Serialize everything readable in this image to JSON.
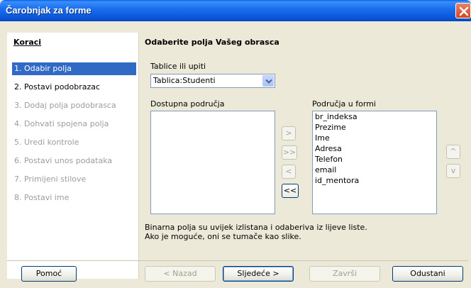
{
  "window": {
    "title": "Čarobnjak za forme"
  },
  "steps": {
    "heading": "Koraci",
    "items": [
      {
        "label": "1. Odabir polja"
      },
      {
        "label": "2. Postavi podobrazac"
      },
      {
        "label": "3. Dodaj polja podobrasca"
      },
      {
        "label": "4. Dohvati spojena polja"
      },
      {
        "label": "5. Uredi kontrole"
      },
      {
        "label": "6. Postavi unos podataka"
      },
      {
        "label": "7. Primijeni stilove"
      },
      {
        "label": "8. Postavi ime"
      }
    ]
  },
  "main": {
    "heading": "Odaberite polja Vašeg obrasca",
    "tables_label": "Tablice ili upiti",
    "table_selected": "Tablica:Studenti",
    "available_label": "Dostupna područja",
    "form_fields_label": "Područja u formi",
    "form_fields": [
      "br_indeksa",
      "Prezime",
      "Ime",
      "Adresa",
      "Telefon",
      "email",
      "id_mentora"
    ],
    "move": {
      "add_one": ">",
      "add_all": ">>",
      "remove_one": "<",
      "remove_all": "<<"
    },
    "order": {
      "up": "^",
      "down": "v"
    },
    "note_line1": "Binarna polja su uvijek izlistana i odaberiva iz lijeve liste.",
    "note_line2": "Ako je moguće, oni se tumače kao slike."
  },
  "buttons": {
    "help": "Pomoć",
    "back": "< Nazad",
    "next": "Sljedeće >",
    "finish": "Završi",
    "cancel": "Odustani"
  },
  "colors": {
    "selection": "#316ac5",
    "titlebar": "#0a5fe8"
  }
}
